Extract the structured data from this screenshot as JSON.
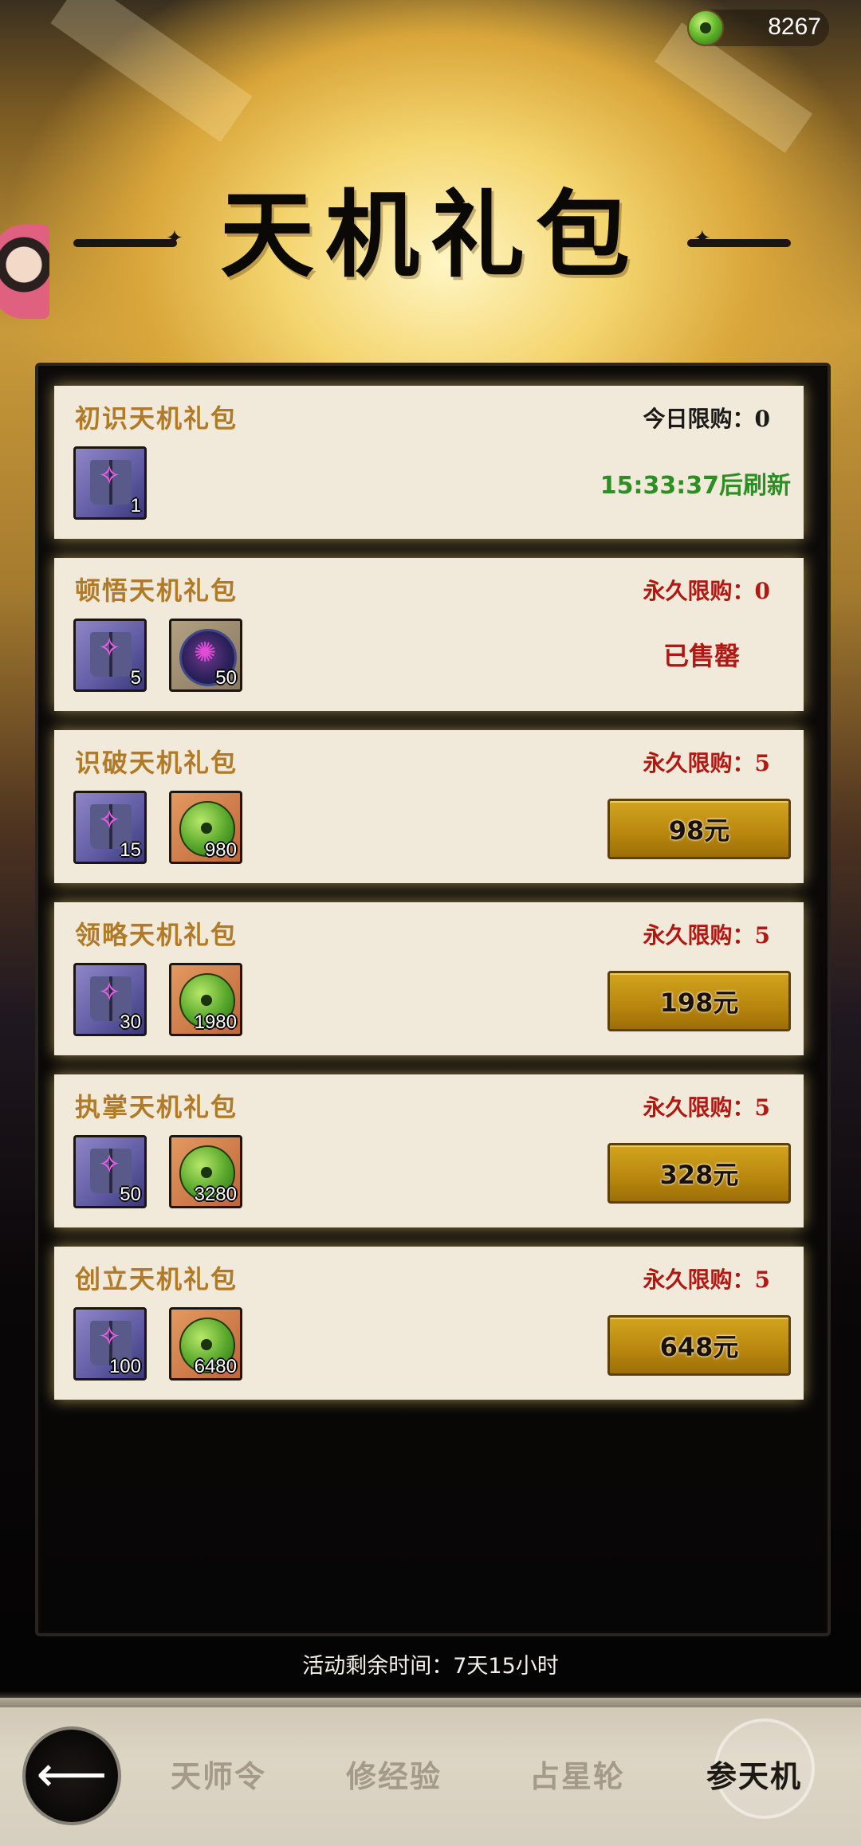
{
  "currency": {
    "value": "8267"
  },
  "title": "天机礼包",
  "packs": [
    {
      "name": "初识天机礼包",
      "limit": "今日限购：0",
      "refresh": "15:33:37后刷新",
      "items": [
        {
          "type": "book",
          "qty": "1"
        }
      ]
    },
    {
      "name": "顿悟天机礼包",
      "limit": "永久限购：0",
      "status": "已售罄",
      "items": [
        {
          "type": "book",
          "qty": "5"
        },
        {
          "type": "orb",
          "qty": "50"
        }
      ]
    },
    {
      "name": "识破天机礼包",
      "limit": "永久限购：5",
      "price": "98元",
      "items": [
        {
          "type": "book",
          "qty": "15"
        },
        {
          "type": "coin",
          "qty": "980"
        }
      ]
    },
    {
      "name": "领略天机礼包",
      "limit": "永久限购：5",
      "price": "198元",
      "items": [
        {
          "type": "book",
          "qty": "30"
        },
        {
          "type": "coin",
          "qty": "1980"
        }
      ]
    },
    {
      "name": "执掌天机礼包",
      "limit": "永久限购：5",
      "price": "328元",
      "items": [
        {
          "type": "book",
          "qty": "50"
        },
        {
          "type": "coin",
          "qty": "3280"
        }
      ]
    },
    {
      "name": "创立天机礼包",
      "limit": "永久限购：5",
      "price": "648元",
      "items": [
        {
          "type": "book",
          "qty": "100"
        },
        {
          "type": "coin",
          "qty": "6480"
        }
      ]
    }
  ],
  "remaining_time": "活动剩余时间：7天15小时",
  "nav": {
    "back_icon": "back-arrow-icon",
    "tabs": [
      "天师令",
      "修经验",
      "占星轮",
      "参天机"
    ],
    "active": "参天机"
  },
  "colors": {
    "accent": "#b8860e",
    "title": "#b07a26",
    "limit": "#b01812",
    "refresh": "#2c8f24"
  }
}
